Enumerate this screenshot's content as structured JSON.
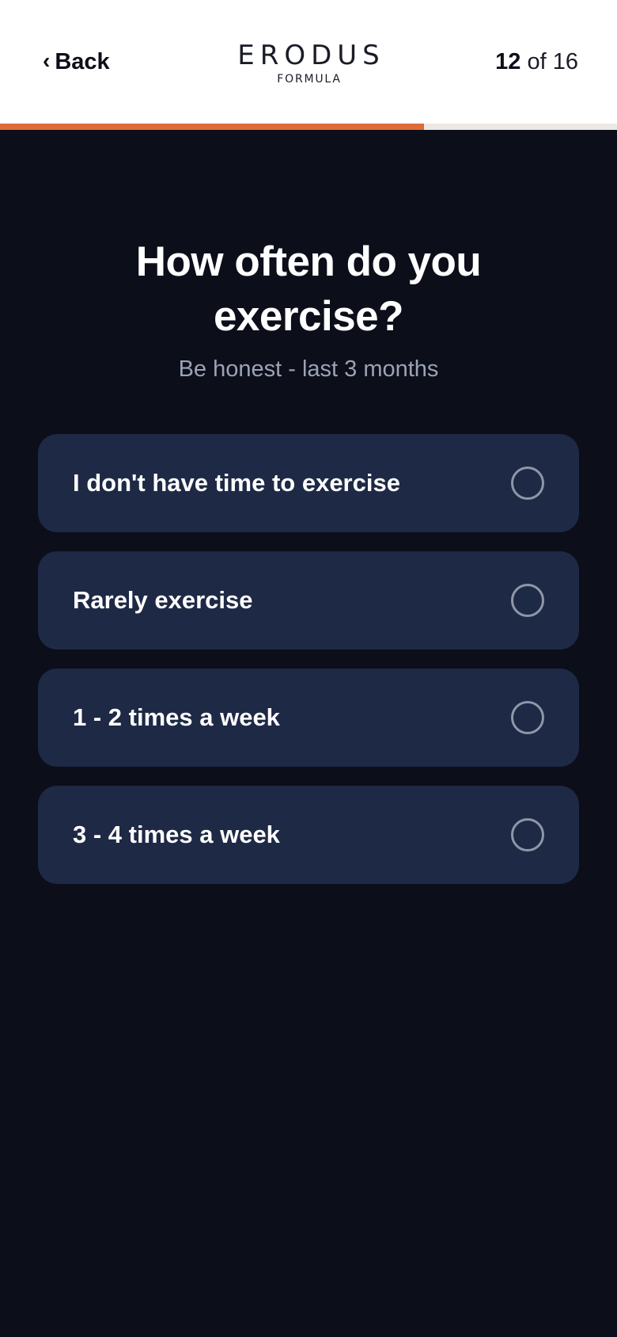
{
  "header": {
    "back_chevron": "‹",
    "back_label": "Back",
    "logo_main": "ERODUS",
    "logo_sub": "FORMULA",
    "step_current": "12",
    "step_separator": "of",
    "step_total": "16"
  },
  "progress": {
    "fraction": 0.6875,
    "fill_color": "#e06a3a",
    "track_color": "#ece8e4"
  },
  "question": {
    "title": "How often do you exercise?",
    "subtitle": "Be honest - last 3 months"
  },
  "options": [
    {
      "label": "I don't have time to exercise",
      "selected": false
    },
    {
      "label": "Rarely exercise",
      "selected": false
    },
    {
      "label": "1 - 2 times a week",
      "selected": false
    },
    {
      "label": "3 - 4 times a week",
      "selected": false
    }
  ],
  "icons": {
    "back": "chevron-left-icon",
    "radio": "radio-unchecked-icon"
  },
  "colors": {
    "background": "#0c0e1a",
    "card": "#1e2945",
    "accent": "#e06a3a"
  }
}
